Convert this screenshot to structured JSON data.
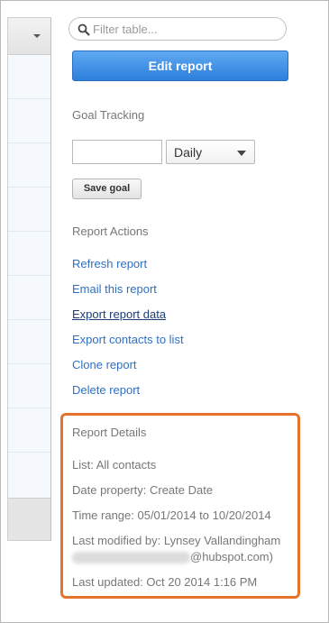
{
  "filter": {
    "placeholder": "Filter table..."
  },
  "buttons": {
    "edit_report": "Edit report",
    "save_goal": "Save goal"
  },
  "goal_tracking": {
    "title": "Goal Tracking",
    "period": "Daily",
    "goal_value": ""
  },
  "report_actions": {
    "title": "Report Actions",
    "links": [
      "Refresh report",
      "Email this report",
      "Export report data",
      "Export contacts to list",
      "Clone report",
      "Delete report"
    ]
  },
  "report_details": {
    "title": "Report Details",
    "list": "List: All contacts",
    "date_property": "Date property: Create Date",
    "time_range": "Time range: 05/01/2014 to 10/20/2014",
    "last_modified_by": "Last modified by: Lynsey Vallandingham",
    "modified_email_suffix": "@hubspot.com)",
    "last_updated": "Last updated: Oct 20 2014 1:16 PM"
  },
  "colors": {
    "accent_orange": "#e5732b",
    "link_blue": "#2f6fc4",
    "button_blue": "#3a8ae2"
  },
  "icons": {
    "filter": "search-icon",
    "table_header": "caret-down-icon",
    "select": "chevron-down-icon"
  }
}
